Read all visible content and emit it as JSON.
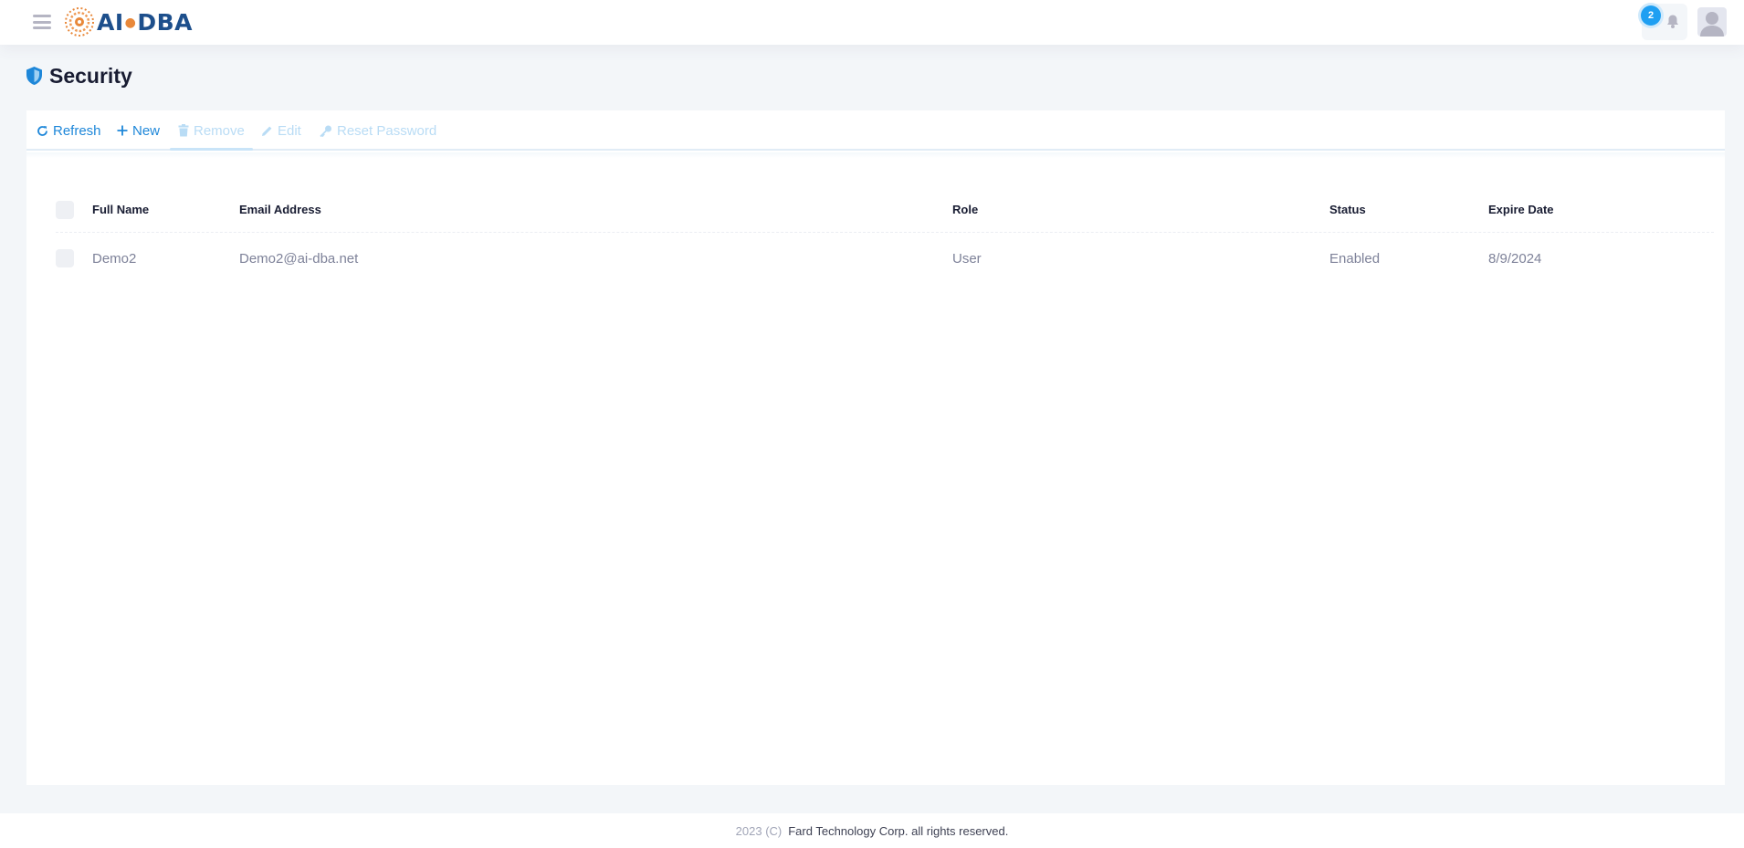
{
  "header": {
    "brand_text_left": "AI",
    "brand_text_right": "DBA",
    "notifications_count": "2"
  },
  "page": {
    "title": "Security"
  },
  "toolbar": {
    "refresh_label": "Refresh",
    "new_label": "New",
    "remove_label": "Remove",
    "edit_label": "Edit",
    "reset_password_label": "Reset Password"
  },
  "table": {
    "headers": {
      "full_name": "Full Name",
      "email": "Email Address",
      "role": "Role",
      "status": "Status",
      "expire_date": "Expire Date"
    },
    "rows": [
      {
        "full_name": "Demo2",
        "email": "Demo2@ai-dba.net",
        "role": "User",
        "status": "Enabled",
        "expire_date": "8/9/2024"
      }
    ]
  },
  "footer": {
    "year": "2023 (C)",
    "company": "Fard Technology Corp. all rights reserved."
  },
  "colors": {
    "accent": "#1e87d9",
    "brand_blue": "#1d4f8c",
    "brand_orange": "#e8883a",
    "badge": "#1e9ff2"
  },
  "icons": {
    "menu": "hamburger-icon",
    "title": "shield-icon",
    "refresh": "refresh-icon",
    "new": "plus-icon",
    "remove": "trash-icon",
    "edit": "pencil-icon",
    "reset_password": "key-icon",
    "notifications": "bell-icon",
    "user": "user-avatar-icon"
  }
}
